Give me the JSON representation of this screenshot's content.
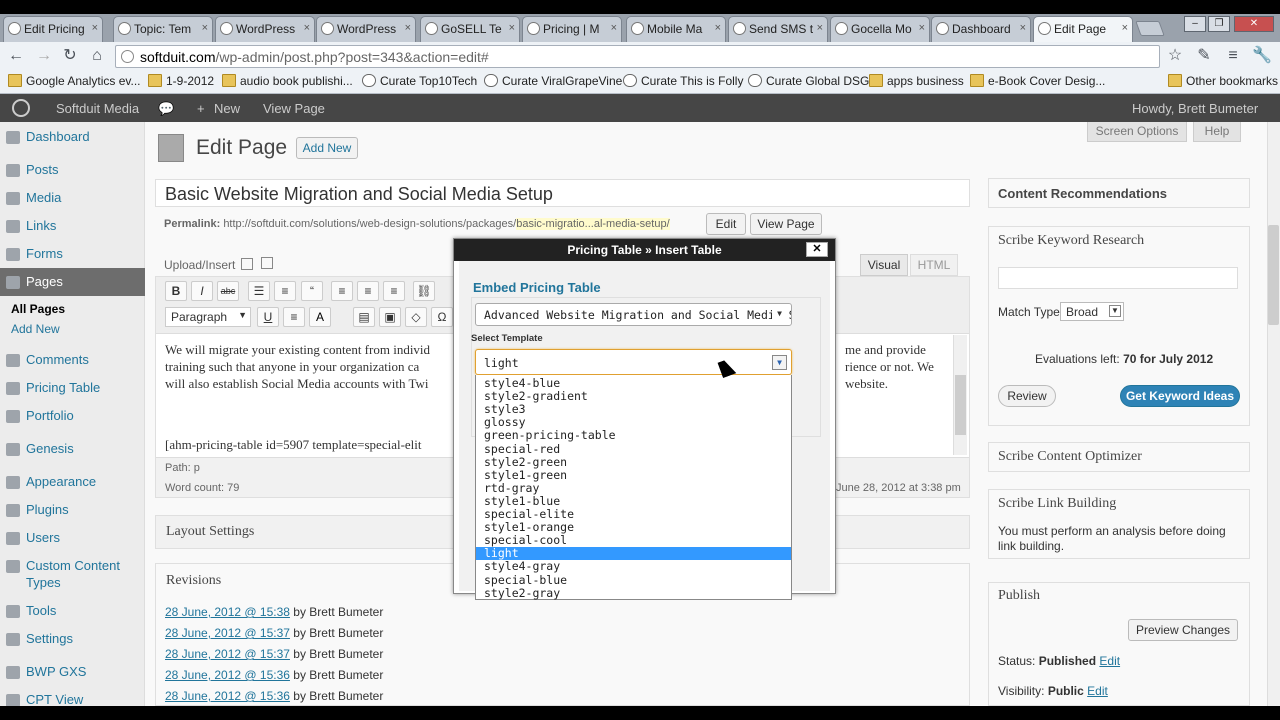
{
  "browser": {
    "tabs": [
      {
        "label": "Edit Pricing"
      },
      {
        "label": "Topic: Tem"
      },
      {
        "label": "WordPress"
      },
      {
        "label": "WordPress"
      },
      {
        "label": "GoSELL Te"
      },
      {
        "label": "Pricing | M"
      },
      {
        "label": "Mobile Ma"
      },
      {
        "label": "Send SMS t"
      },
      {
        "label": "Gocella Mo"
      },
      {
        "label": "Dashboard"
      },
      {
        "label": "Edit Page"
      }
    ],
    "url_host": "softduit.com",
    "url_path": "/wp-admin/post.php?post=343&action=edit#",
    "bookmarks": [
      {
        "label": "Google Analytics ev..."
      },
      {
        "label": "1-9-2012"
      },
      {
        "label": "audio book publishi..."
      },
      {
        "label": "Curate Top10Tech"
      },
      {
        "label": "Curate ViralGrapeVine"
      },
      {
        "label": "Curate This is Folly"
      },
      {
        "label": "Curate Global DSG"
      },
      {
        "label": "apps business"
      },
      {
        "label": "e-Book Cover Desig..."
      },
      {
        "label": "Other bookmarks"
      }
    ]
  },
  "adminbar": {
    "site": "Softduit Media",
    "new": "New",
    "view_page": "View Page",
    "howdy": "Howdy, Brett Bumeter"
  },
  "sidebar": {
    "items": [
      {
        "label": "Dashboard"
      },
      {
        "label": "Posts"
      },
      {
        "label": "Media"
      },
      {
        "label": "Links"
      },
      {
        "label": "Forms"
      },
      {
        "label": "Pages"
      },
      {
        "label": "Comments"
      },
      {
        "label": "Pricing Table"
      },
      {
        "label": "Portfolio"
      },
      {
        "label": "Genesis"
      },
      {
        "label": "Appearance"
      },
      {
        "label": "Plugins"
      },
      {
        "label": "Users"
      },
      {
        "label": "Custom Content Types"
      },
      {
        "label": "Tools"
      },
      {
        "label": "Settings"
      },
      {
        "label": "BWP GXS"
      },
      {
        "label": "CPT View"
      }
    ],
    "pages_sub": [
      "All Pages",
      "Add New"
    ]
  },
  "main": {
    "heading": "Edit Page",
    "add_new": "Add New",
    "screen_options": "Screen Options",
    "help": "Help",
    "post_title": "Basic Website Migration and Social Media Setup",
    "permalink_label": "Permalink:",
    "permalink_base": "http://softduit.com/solutions/web-design-solutions/packages/",
    "permalink_slug": "basic-migratio...al-media-setup/",
    "edit_btn": "Edit",
    "view_page_btn": "View Page",
    "upload_insert": "Upload/Insert",
    "visual_tab": "Visual",
    "html_tab": "HTML",
    "format_select": "Paragraph",
    "body_line1": "We will migrate your existing content from individ",
    "body_line1_right": "me and provide",
    "body_line2": "training such that anyone in your organization ca",
    "body_line2_right": "rience or not.  We",
    "body_line3": "will also establish Social Media accounts with Twi",
    "body_line3_right": "website.",
    "shortcode": "[ahm-pricing-table id=5907 template=special-elit",
    "path": "Path: p",
    "word_count": "Word count: 79",
    "last_edited": "June 28, 2012 at 3:38 pm",
    "layout_settings": "Layout Settings",
    "revisions_title": "Revisions",
    "revisions": [
      {
        "date": "28 June, 2012 @ 15:38",
        "by": "by Brett Bumeter"
      },
      {
        "date": "28 June, 2012 @ 15:37",
        "by": "by Brett Bumeter"
      },
      {
        "date": "28 June, 2012 @ 15:37",
        "by": "by Brett Bumeter"
      },
      {
        "date": "28 June, 2012 @ 15:36",
        "by": "by Brett Bumeter"
      },
      {
        "date": "28 June, 2012 @ 15:36",
        "by": "by Brett Bumeter"
      }
    ]
  },
  "right": {
    "content_rec": "Content Recommendations",
    "keyword_research": "Scribe Keyword Research",
    "match_type_label": "Match Type",
    "match_type_value": "Broad",
    "evaluations": "Evaluations left:",
    "evaluations_val": "70 for July 2012",
    "review_btn": "Review",
    "keyword_btn": "Get Keyword Ideas",
    "content_optimizer": "Scribe Content Optimizer",
    "link_building": "Scribe Link Building",
    "link_building_msg": "You must perform an analysis before doing link building.",
    "publish": "Publish",
    "preview_changes": "Preview Changes",
    "status_label": "Status:",
    "status_val": "Published",
    "status_edit": "Edit",
    "visibility_label": "Visibility:",
    "visibility_val": "Public",
    "visibility_edit": "Edit"
  },
  "modal": {
    "title": "Pricing Table » Insert Table",
    "close": "✕",
    "section": "Embed Pricing Table",
    "table_select": "Advanced Website Migration and Social Media S",
    "template_label": "Select Template",
    "template_value": "light",
    "options": [
      "style4-blue",
      "style2-gradient",
      "style3",
      "glossy",
      "green-pricing-table",
      "special-red",
      "style2-green",
      "style1-green",
      "rtd-gray",
      "style1-blue",
      "special-elite",
      "style1-orange",
      "special-cool",
      "light",
      "style4-gray",
      "special-blue",
      "style2-gray"
    ],
    "highlighted_index": 13
  }
}
